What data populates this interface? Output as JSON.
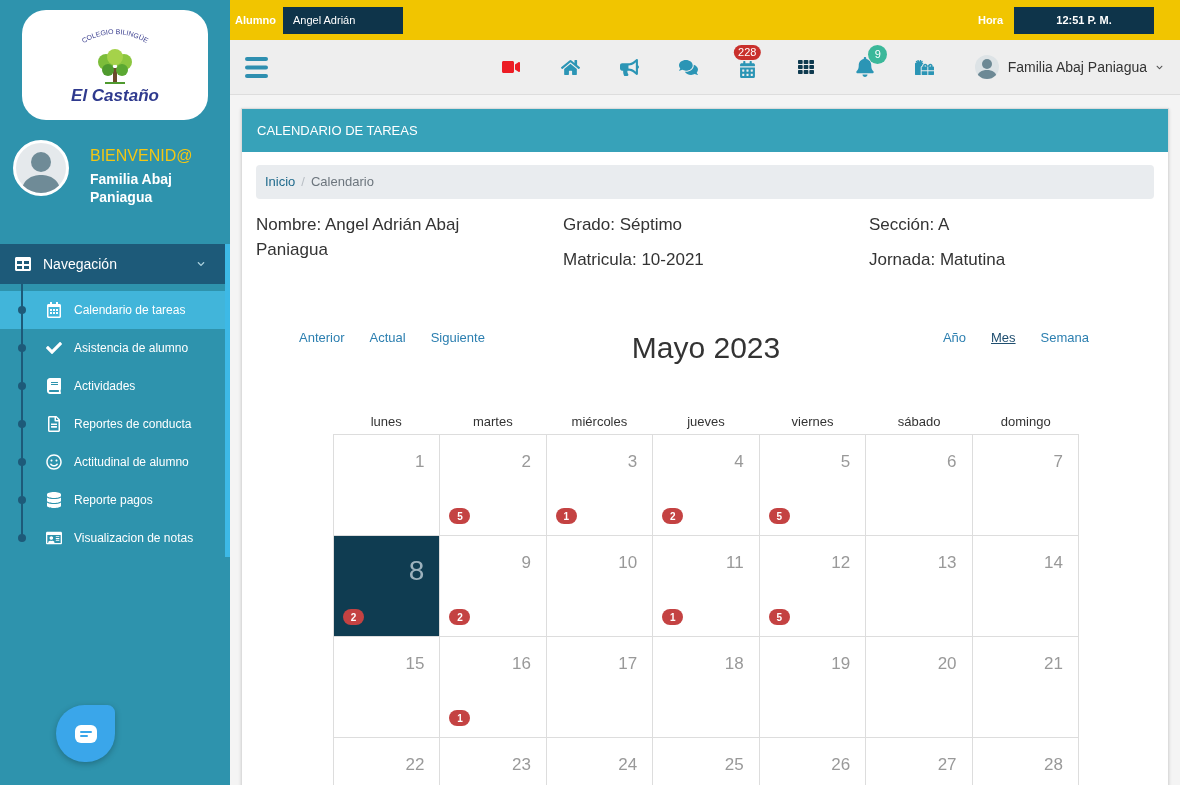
{
  "sidebar": {
    "logo": {
      "arc_text": "COLEGIO BILINGÜE",
      "name": "El Castaño"
    },
    "welcome": "BIENVENID@",
    "user_name": "Familia Abaj Paniagua",
    "nav": {
      "label": "Navegación",
      "expanded": true
    },
    "items": [
      {
        "label": "Calendario de tareas",
        "selected": true
      },
      {
        "label": "Asistencia de alumno",
        "selected": false
      },
      {
        "label": "Actividades",
        "selected": false
      },
      {
        "label": "Reportes de conducta",
        "selected": false
      },
      {
        "label": "Actitudinal de alumno",
        "selected": false
      },
      {
        "label": "Reporte pagos",
        "selected": false
      },
      {
        "label": "Visualizacion de notas",
        "selected": false
      }
    ]
  },
  "top_bar": {
    "student_label": "Alumno",
    "student": "Angel Adrián",
    "time_label": "Hora",
    "time": "12:51 P. M."
  },
  "toolbar": {
    "icons": [
      {
        "kind": "video"
      },
      {
        "kind": "home"
      },
      {
        "kind": "megaphone"
      },
      {
        "kind": "chat"
      },
      {
        "kind": "calendar",
        "badge": "228",
        "color": "#c9302c"
      },
      {
        "kind": "apps"
      },
      {
        "kind": "bell",
        "badge": "9",
        "color": "#3bb89a"
      },
      {
        "kind": "gifts"
      }
    ],
    "user": "Familia Abaj Paniagua"
  },
  "card": {
    "title": "CALENDARIO DE TAREAS",
    "breadcrumb": [
      {
        "label": "Inicio",
        "kind": "link"
      },
      {
        "label": "Calendario",
        "kind": "current"
      }
    ],
    "breadcrumb_separator": "/",
    "info_columns": [
      [
        "Nombre: Angel Adrián Abaj Paniagua"
      ],
      [
        "Grado: Séptimo",
        "Matricula: 10-2021"
      ],
      [
        "Sección: A",
        "Jornada: Matutina"
      ]
    ],
    "calendar": {
      "nav_links": [
        "Anterior",
        "Actual",
        "Siguiente"
      ],
      "title": "Mayo 2023",
      "views": [
        {
          "label": "Año",
          "selected": false
        },
        {
          "label": "Mes",
          "selected": true
        },
        {
          "label": "Semana",
          "selected": false
        }
      ],
      "weekdays": [
        "lunes",
        "martes",
        "miércoles",
        "jueves",
        "viernes",
        "sábado",
        "domingo"
      ],
      "weeks": [
        [
          {
            "day": "1",
            "selected": false
          },
          {
            "day": "2",
            "count": "5",
            "selected": false
          },
          {
            "day": "3",
            "count": "1",
            "selected": false
          },
          {
            "day": "4",
            "count": "2",
            "selected": false
          },
          {
            "day": "5",
            "count": "5",
            "selected": false
          },
          {
            "day": "6",
            "selected": false
          },
          {
            "day": "7",
            "selected": false
          }
        ],
        [
          {
            "day": "8",
            "count": "2",
            "selected": true
          },
          {
            "day": "9",
            "count": "2",
            "selected": false
          },
          {
            "day": "10",
            "selected": false
          },
          {
            "day": "11",
            "count": "1",
            "selected": false
          },
          {
            "day": "12",
            "count": "5",
            "selected": false
          },
          {
            "day": "13",
            "selected": false
          },
          {
            "day": "14",
            "selected": false
          }
        ],
        [
          {
            "day": "15",
            "selected": false
          },
          {
            "day": "16",
            "count": "1",
            "selected": false
          },
          {
            "day": "17",
            "selected": false
          },
          {
            "day": "18",
            "selected": false
          },
          {
            "day": "19",
            "selected": false
          },
          {
            "day": "20",
            "selected": false
          },
          {
            "day": "21",
            "selected": false
          }
        ],
        [
          {
            "day": "22",
            "selected": false
          },
          {
            "day": "23",
            "selected": false
          },
          {
            "day": "24",
            "selected": false
          },
          {
            "day": "25",
            "selected": false
          },
          {
            "day": "26",
            "selected": false
          },
          {
            "day": "27",
            "selected": false
          },
          {
            "day": "28",
            "selected": false
          }
        ]
      ]
    }
  }
}
